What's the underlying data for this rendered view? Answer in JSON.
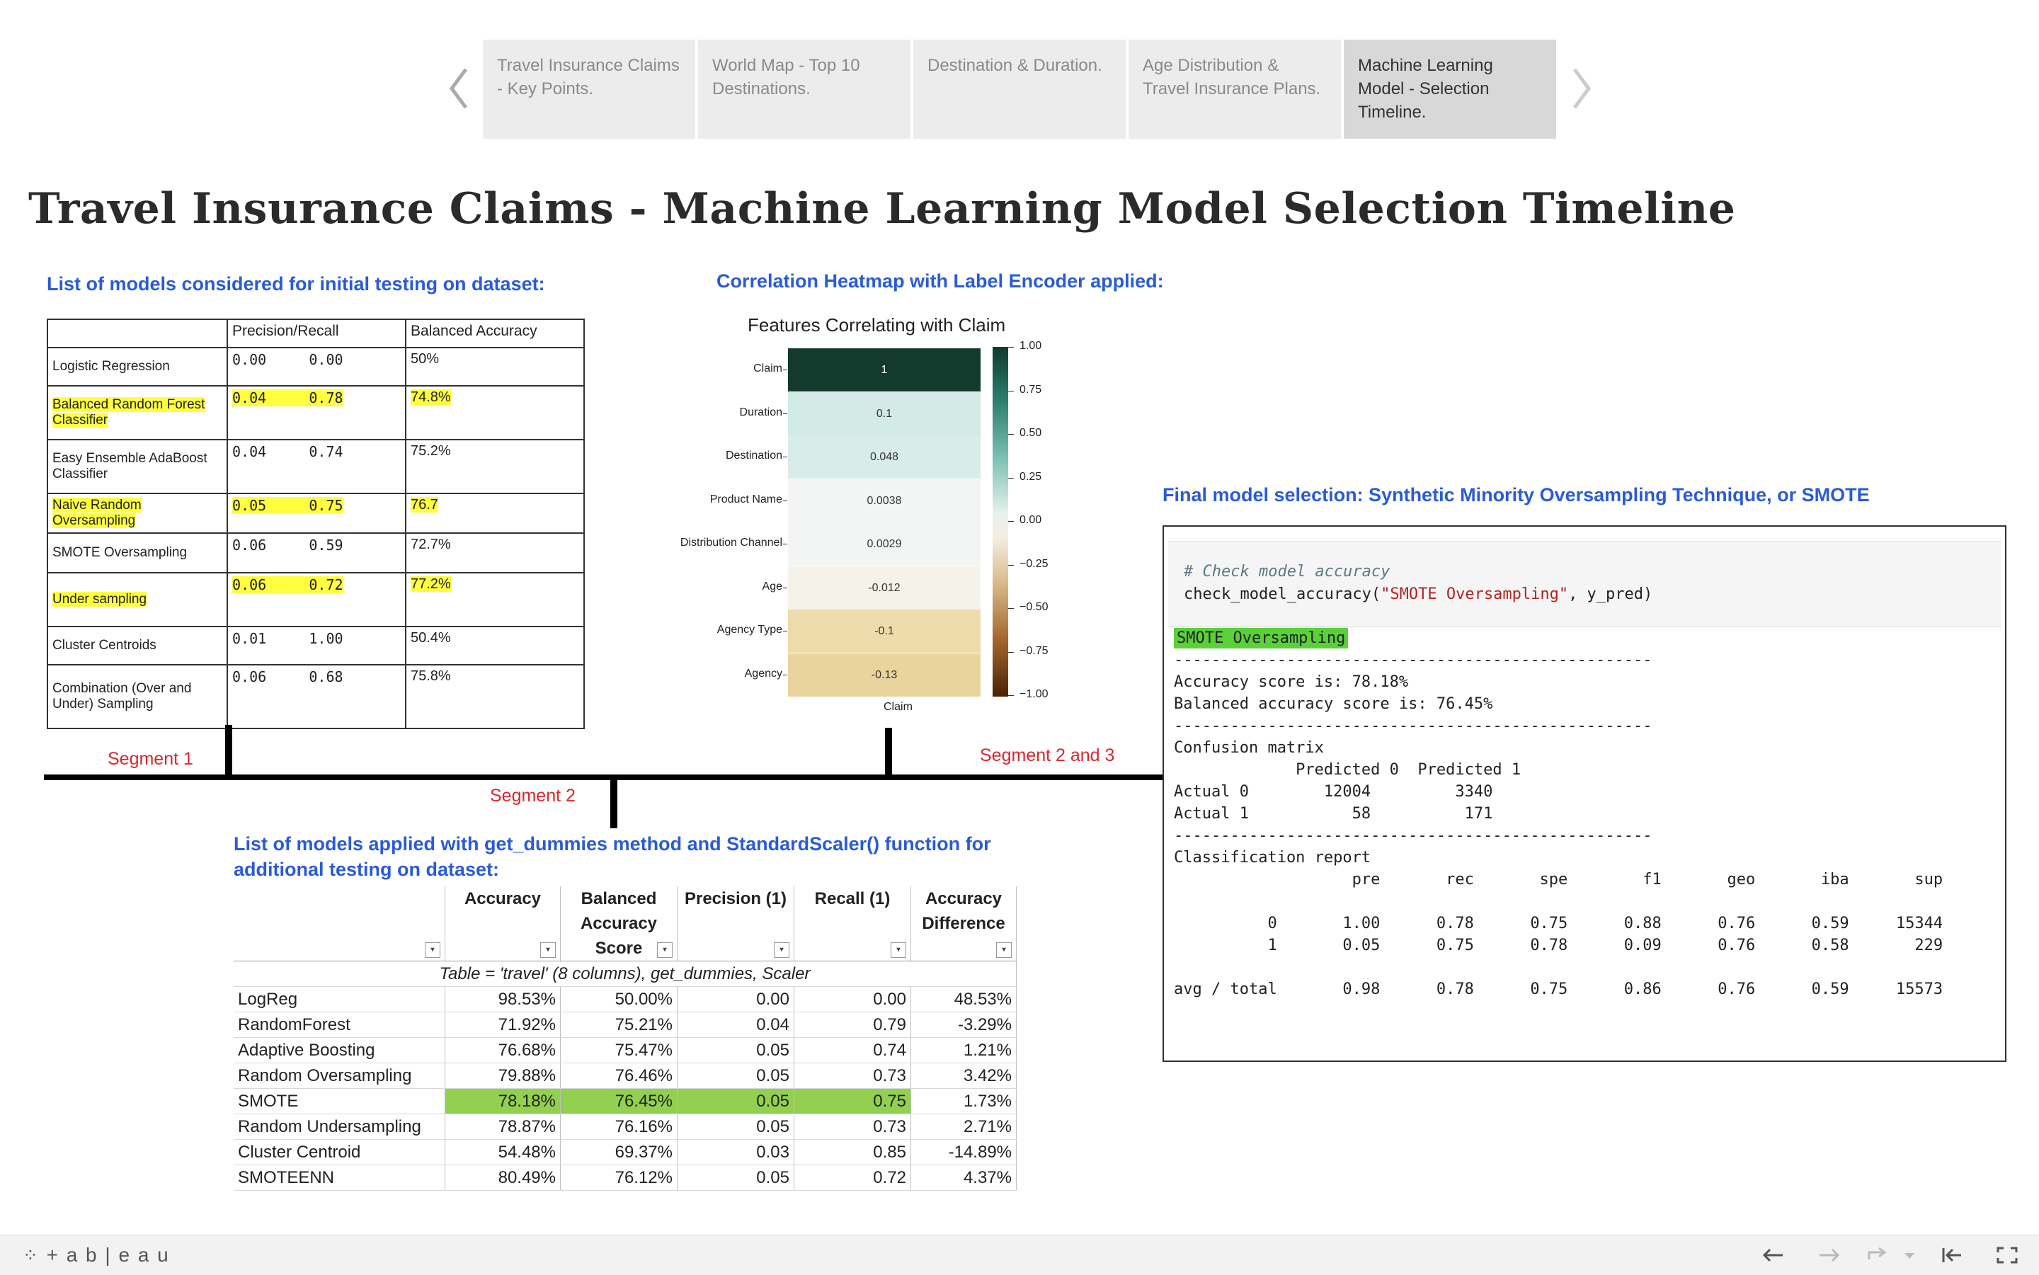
{
  "story_nav": {
    "tabs": [
      {
        "label": "Travel Insurance Claims - Key Points."
      },
      {
        "label": "World Map - Top 10 Destinations."
      },
      {
        "label": "Destination & Duration."
      },
      {
        "label": "Age Distribution & Travel Insurance Plans."
      },
      {
        "label": "Machine Learning Model - Selection Timeline."
      }
    ],
    "active_index": 4
  },
  "page_title": "Travel Insurance Claims - Machine Learning Model Selection Timeline",
  "colors": {
    "heading_blue": "#2a5bd7",
    "segment_red": "#d9272e",
    "highlight_yellow": "#ffff40",
    "highlight_green": "#92d050"
  },
  "initial_models": {
    "heading": "List of models considered for initial testing on dataset:",
    "columns": [
      "",
      "Precision/Recall",
      "Balanced Accuracy"
    ],
    "rows": [
      {
        "model": "Logistic Regression",
        "pr": "0.00     0.00",
        "ba": "50%",
        "highlight": false
      },
      {
        "model": "Balanced Random Forest Classifier",
        "pr": "0.04     0.78",
        "ba": "74.8%",
        "highlight": true
      },
      {
        "model": "Easy Ensemble AdaBoost Classifier",
        "pr": "0.04     0.74",
        "ba": "75.2%",
        "highlight": false
      },
      {
        "model": "Naive Random Oversampling",
        "pr": "0.05     0.75",
        "ba": "76.7",
        "highlight": true
      },
      {
        "model": "SMOTE Oversampling",
        "pr": "0.06     0.59",
        "ba": "72.7%",
        "highlight": false
      },
      {
        "model": "Under sampling",
        "pr": "0.06     0.72",
        "ba": "77.2%",
        "highlight": true
      },
      {
        "model": "Cluster Centroids",
        "pr": "0.01     1.00",
        "ba": "50.4%",
        "highlight": false
      },
      {
        "model": "Combination (Over and Under) Sampling",
        "pr": "0.06     0.68",
        "ba": "75.8%",
        "highlight": false
      }
    ]
  },
  "heatmap": {
    "heading": "Correlation Heatmap with Label Encoder applied:",
    "title": "Features Correlating with Claim",
    "x_label": "Claim",
    "colorbar_ticks": [
      "1.00",
      "0.75",
      "0.50",
      "0.25",
      "0.00",
      "−0.25",
      "−0.50",
      "−0.75",
      "−1.00"
    ]
  },
  "chart_data": {
    "type": "heatmap",
    "title": "Features Correlating with Claim",
    "x": [
      "Claim"
    ],
    "y": [
      "Claim",
      "Duration",
      "Destination",
      "Product Name",
      "Distribution Channel",
      "Age",
      "Agency Type",
      "Agency"
    ],
    "values": [
      "1",
      "0.1",
      "0.048",
      "0.0038",
      "0.0029",
      "-0.012",
      "-0.1",
      "-0.13"
    ],
    "vrange": [
      -1,
      1
    ]
  },
  "timeline": {
    "segments": [
      "Segment 1",
      "Segment 2",
      "Segment 2 and 3"
    ]
  },
  "applied_models": {
    "heading_line1": "List of models applied with get_dummies method and StandardScaler() function for",
    "heading_line2": "additional testing on dataset:",
    "columns": [
      {
        "l1": "",
        "l2": "",
        "l3": ""
      },
      {
        "l1": "Accuracy",
        "l2": "",
        "l3": ""
      },
      {
        "l1": "Balanced",
        "l2": "Accuracy",
        "l3": "Score"
      },
      {
        "l1": "Precision (1)",
        "l2": "",
        "l3": ""
      },
      {
        "l1": "Recall (1)",
        "l2": "",
        "l3": ""
      },
      {
        "l1": "Accuracy",
        "l2": "Difference",
        "l3": ""
      }
    ],
    "caption": "Table = 'travel' (8 columns), get_dummies, Scaler",
    "rows": [
      {
        "model": "LogReg",
        "acc": "98.53%",
        "bal": "50.00%",
        "prec": "0.00",
        "rec": "0.00",
        "diff": "48.53%"
      },
      {
        "model": "RandomForest",
        "acc": "71.92%",
        "bal": "75.21%",
        "prec": "0.04",
        "rec": "0.79",
        "diff": "-3.29%"
      },
      {
        "model": "Adaptive Boosting",
        "acc": "76.68%",
        "bal": "75.47%",
        "prec": "0.05",
        "rec": "0.74",
        "diff": "1.21%"
      },
      {
        "model": "Random Oversampling",
        "acc": "79.88%",
        "bal": "76.46%",
        "prec": "0.05",
        "rec": "0.73",
        "diff": "3.42%"
      },
      {
        "model": "SMOTE",
        "acc": "78.18%",
        "bal": "76.45%",
        "prec": "0.05",
        "rec": "0.75",
        "diff": "1.73%"
      },
      {
        "model": "Random Undersampling",
        "acc": "78.87%",
        "bal": "76.16%",
        "prec": "0.05",
        "rec": "0.73",
        "diff": "2.71%"
      },
      {
        "model": "Cluster Centroid",
        "acc": "54.48%",
        "bal": "69.37%",
        "prec": "0.03",
        "rec": "0.85",
        "diff": "-14.89%"
      },
      {
        "model": "SMOTEENN",
        "acc": "80.49%",
        "bal": "76.12%",
        "prec": "0.05",
        "rec": "0.72",
        "diff": "4.37%"
      }
    ],
    "green_row": "SMOTE"
  },
  "final_model": {
    "heading": "Final model selection: Synthetic Minority Oversampling Technique, or SMOTE",
    "code_comment": "# Check model accuracy",
    "code_fn": "check_model_accuracy(",
    "code_str": "\"SMOTE Oversampling\"",
    "code_rest": ", y_pred)",
    "output_title": "SMOTE Oversampling",
    "output_body": "---------------------------------------------------\nAccuracy score is: 78.18%\nBalanced accuracy score is: 76.45%\n---------------------------------------------------\nConfusion matrix\n             Predicted 0  Predicted 1\nActual 0        12004         3340\nActual 1           58          171\n---------------------------------------------------\nClassification report\n                   pre       rec       spe        f1       geo       iba       sup\n\n          0       1.00      0.78      0.75      0.88      0.76      0.59     15344\n          1       0.05      0.75      0.78      0.09      0.76      0.58       229\n\navg / total       0.98      0.78      0.75      0.86      0.76      0.59     15573"
  },
  "footer": {
    "brand": "+ a b | e a u",
    "icons": [
      "tableau-logo-icon",
      "undo-icon",
      "redo-icon",
      "revert-icon",
      "revert-dropdown-icon",
      "reset-icon",
      "fullscreen-icon"
    ]
  }
}
